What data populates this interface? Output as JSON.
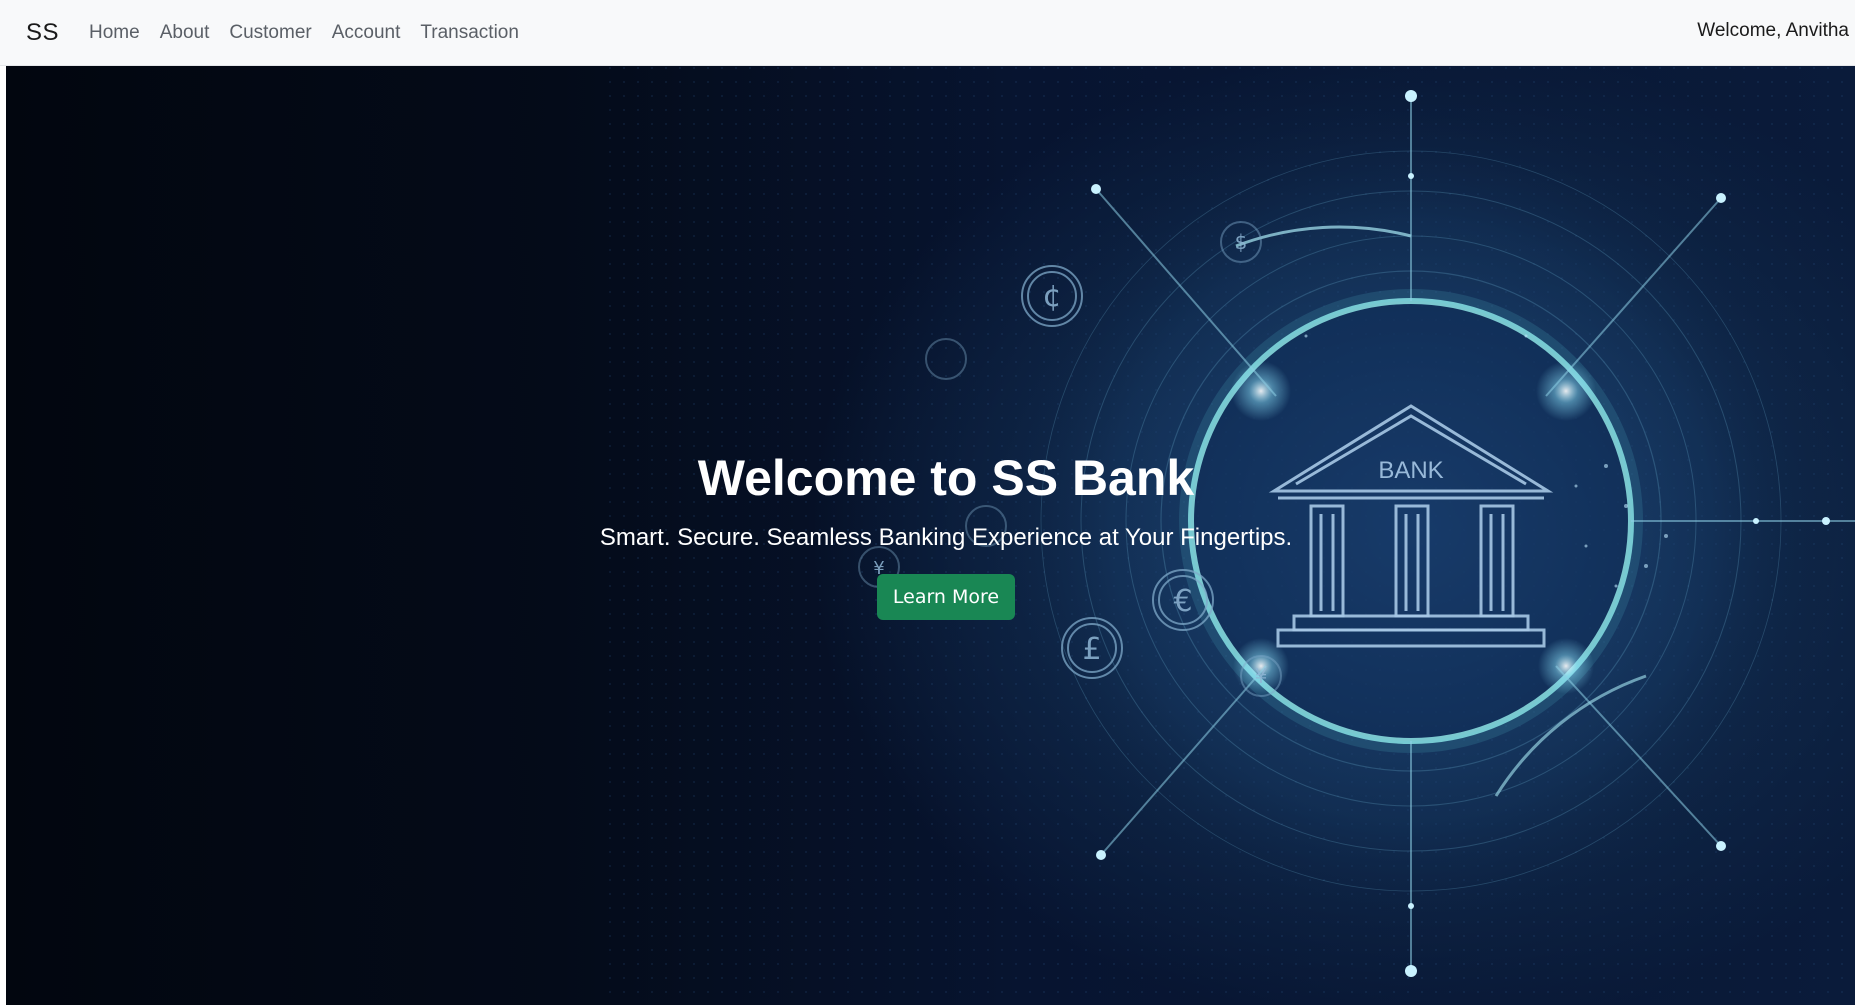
{
  "navbar": {
    "brand": "SS",
    "links": [
      {
        "label": "Home"
      },
      {
        "label": "About"
      },
      {
        "label": "Customer"
      },
      {
        "label": "Account"
      },
      {
        "label": "Transaction"
      }
    ],
    "welcome_text": "Welcome, Anvitha"
  },
  "hero": {
    "title": "Welcome to SS Bank",
    "subtitle": "Smart. Secure. Seamless Banking Experience at Your Fingertips.",
    "button_label": "Learn More",
    "illustration": {
      "building_label": "BANK",
      "currency_symbols": [
        "$",
        "¢",
        "€",
        "£",
        "¥"
      ]
    }
  },
  "colors": {
    "navbar_bg": "#f8f9fa",
    "hero_bg": "#071430",
    "accent_button": "#198754",
    "glow": "#7fe0e6"
  }
}
